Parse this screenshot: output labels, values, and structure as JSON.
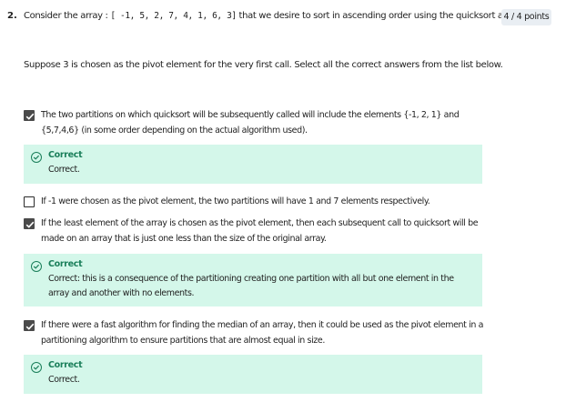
{
  "question": {
    "number": "2.",
    "text_before": "Consider the array : ",
    "array": "[ -1, 5, 2, 7, 4, 1, 6, 3]",
    "text_after": "  that we desire to sort in ascending order using the quicksort algorithm.",
    "points": "4 / 4 points",
    "prompt": "Suppose 3 is chosen as the pivot element for the very first call. Select all the correct answers from the list below."
  },
  "options": [
    {
      "text": "The two partitions on which quicksort will be subsequently called will include the elements {-1, 2, 1} and {5,7,4,6} (in some order depending on the actual algorithm used).",
      "checked": true,
      "feedback": {
        "title": "Correct",
        "text": "Correct."
      }
    },
    {
      "text": "If -1 were chosen as the pivot element, the two partitions will have 1 and 7 elements respectively.",
      "checked": false
    },
    {
      "text": "If the least element of the array is chosen as the pivot element, then each subsequent call to quicksort will be made on an array that is just one less than the size of the original array.",
      "checked": true,
      "feedback": {
        "title": "Correct",
        "text": "Correct: this is a consequence of the partitioning creating one partition with all but one element in the array and another with no elements."
      }
    },
    {
      "text": "If there were a fast algorithm for finding the median of an array, then it could be used as the pivot element in a partitioning algorithm to ensure partitions that are almost equal in size.",
      "checked": true,
      "feedback": {
        "title": "Correct",
        "text": "Correct."
      }
    }
  ],
  "colors": {
    "feedback_bg": "#d4f7ea",
    "correct_green": "#1a7f5a",
    "checkbox_checked": "#4a4a4a"
  },
  "icons": {
    "checkbox": "checkbox-icon",
    "correct": "check-circle-icon"
  }
}
